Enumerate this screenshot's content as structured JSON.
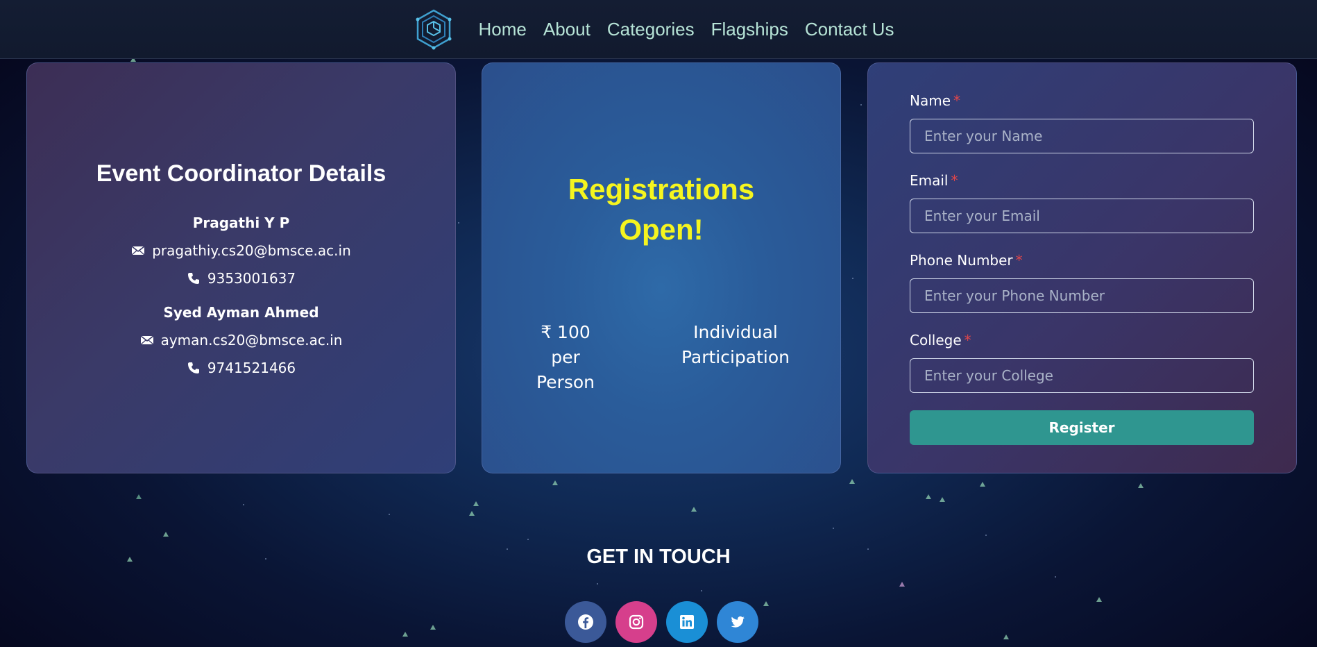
{
  "nav": {
    "logo_icon": "cube-circuit-logo-icon",
    "links": [
      "Home",
      "About",
      "Categories",
      "Flagships",
      "Contact Us"
    ]
  },
  "coordinators": {
    "title": "Event Coordinator Details",
    "people": [
      {
        "name": "Pragathi Y P",
        "email": "pragathiy.cs20@bmsce.ac.in",
        "phone": "9353001637"
      },
      {
        "name": "Syed Ayman Ahmed",
        "email": "ayman.cs20@bmsce.ac.in",
        "phone": "9741521466"
      }
    ]
  },
  "registration": {
    "title_line1": "Registrations",
    "title_line2": "Open!",
    "fee_line1": "₹ 100",
    "fee_line2": "per Person",
    "type_line1": "Individual",
    "type_line2": "Participation"
  },
  "form": {
    "required_mark": "*",
    "name_label": "Name",
    "name_placeholder": "Enter your Name",
    "email_label": "Email",
    "email_placeholder": "Enter your Email",
    "phone_label": "Phone Number",
    "phone_placeholder": "Enter your Phone Number",
    "college_label": "College",
    "college_placeholder": "Enter your College",
    "submit_label": "Register"
  },
  "footer": {
    "heading": "GET IN TOUCH",
    "socials": [
      "facebook-icon",
      "instagram-icon",
      "linkedin-icon",
      "twitter-icon"
    ]
  },
  "colors": {
    "accent_teal": "#2f9690",
    "title_yellow": "#f5f51f",
    "nav_link": "#b6e3d6",
    "required_red": "#e0464a"
  }
}
